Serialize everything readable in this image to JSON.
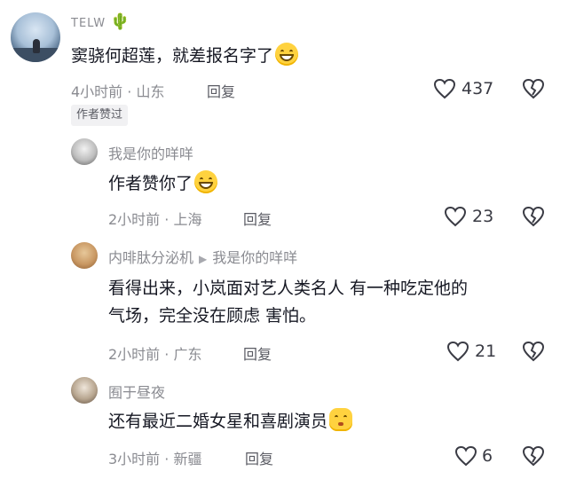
{
  "comments": [
    {
      "username": "TELW",
      "text": "窦骁何超莲，就差报名字了",
      "time": "4小时前",
      "location": "山东",
      "reply_label": "回复",
      "likes": "437",
      "author_liked": "作者赞过"
    },
    {
      "username": "我是你的咩咩",
      "text": "作者赞你了",
      "time": "2小时前",
      "location": "上海",
      "reply_label": "回复",
      "likes": "23"
    },
    {
      "username": "内啡肽分泌机",
      "reply_to": "我是你的咩咩",
      "text_line1": "看得出来，小岚面对艺人类名人 有一种吃定他的",
      "text_line2": "气场，完全没在顾虑 害怕。",
      "time": "2小时前",
      "location": "广东",
      "reply_label": "回复",
      "likes": "21"
    },
    {
      "username": "囿于昼夜",
      "text": "还有最近二婚女星和喜剧演员",
      "time": "3小时前",
      "location": "新疆",
      "reply_label": "回复",
      "likes": "6"
    }
  ],
  "separator": "·",
  "icons": {
    "like": "heart-icon",
    "dislike": "broken-heart-icon",
    "reply_arrow": "triangle-right-icon",
    "cactus": "cactus-emoji"
  },
  "colors": {
    "text": "#161823",
    "muted": "#8a8b91",
    "badge_bg": "#f1f1f3"
  }
}
